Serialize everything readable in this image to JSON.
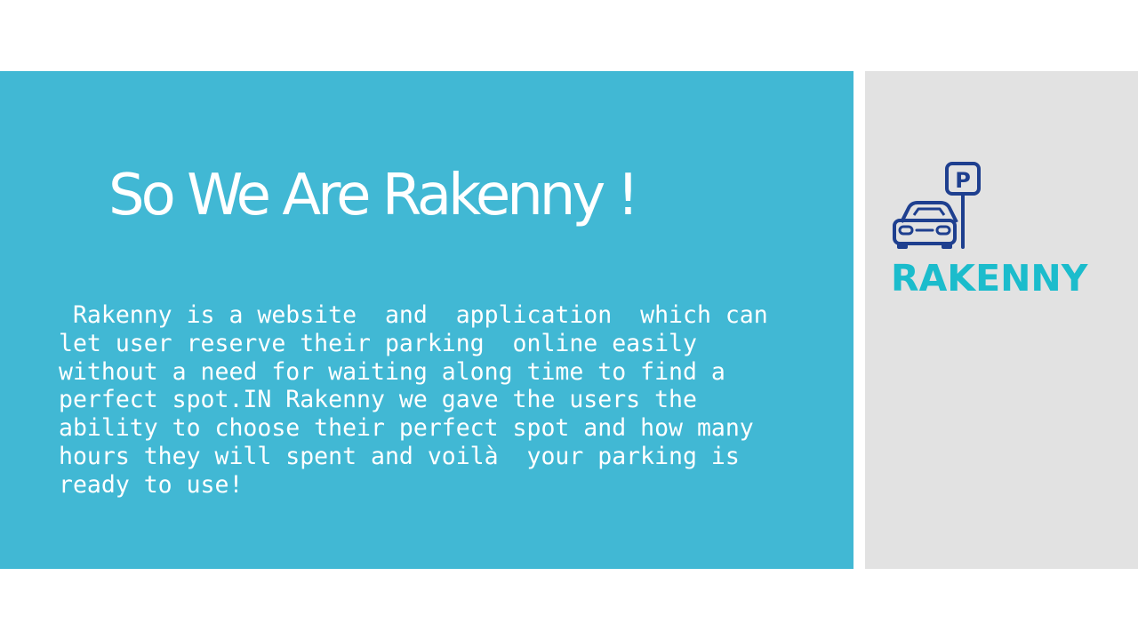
{
  "slide": {
    "title": "So We Are Rakenny !",
    "body": " Rakenny is a website  and  application  which can\nlet user reserve their parking  online easily\nwithout a need for waiting along time to find a\nperfect spot.IN Rakenny we gave the users the\nability to choose their perfect spot and how many\nhours they will spent and voilà  your parking is\nready to use!"
  },
  "logo": {
    "wordmark": "RAKENNY",
    "sign_letter": "P",
    "icon": "car-parking-icon"
  },
  "colors": {
    "panel_blue": "#41b8d4",
    "panel_gray": "#e2e2e2",
    "logo_navy": "#1e3f8f",
    "logo_teal": "#1bbccc"
  }
}
